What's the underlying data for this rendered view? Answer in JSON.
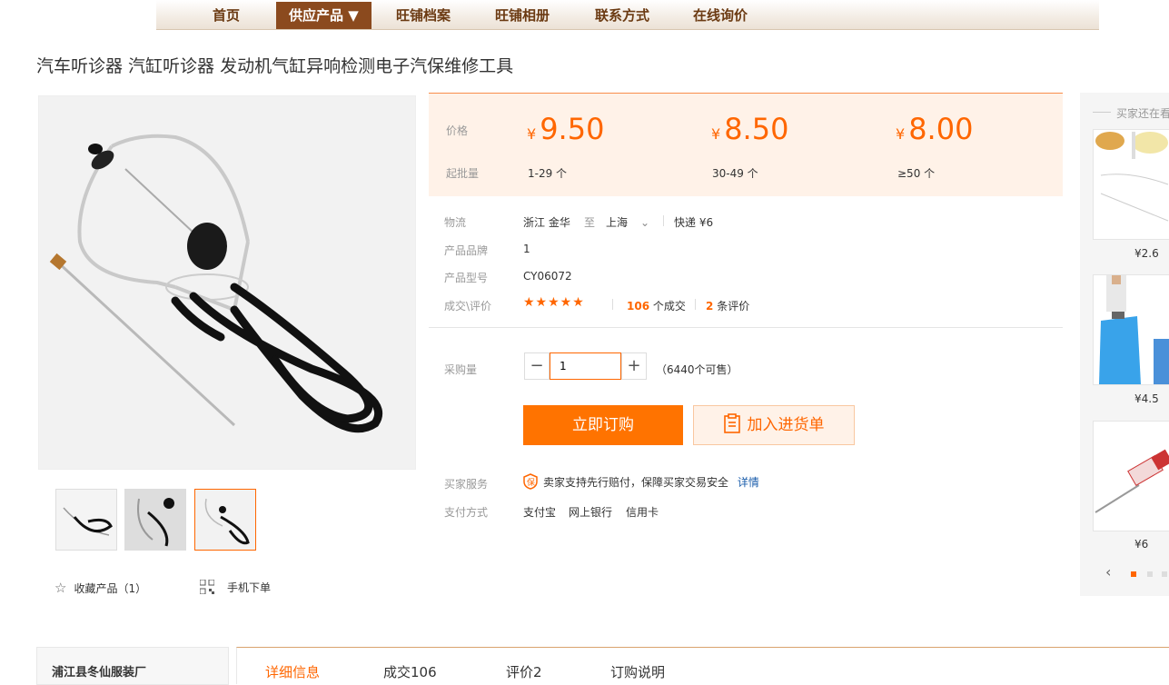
{
  "nav": {
    "items": [
      "首页",
      "供应产品 ▼",
      "旺铺档案",
      "旺铺相册",
      "联系方式",
      "在线询价"
    ],
    "active_index": 1
  },
  "product": {
    "title": "汽车听诊器 汽缸听诊器 发动机气缸异响检测电子汽保维修工具"
  },
  "pricing": {
    "price_label": "价格",
    "moq_label": "起批量",
    "currency": "¥",
    "tiers": [
      {
        "price": "9.50",
        "range": "1-29 个"
      },
      {
        "price": "8.50",
        "range": "30-49 个"
      },
      {
        "price": "8.00",
        "range": "≥50 个"
      }
    ]
  },
  "details": {
    "logistics_label": "物流",
    "origin": "浙江 金华",
    "to": "至",
    "destination": "上海",
    "shipping": "快递 ¥6",
    "brand_label": "产品品牌",
    "brand": "1",
    "model_label": "产品型号",
    "model": "CY06072",
    "rating_label": "成交\\评价",
    "stars": "★★★★★",
    "deals_count": "106",
    "deals_unit": "个成交",
    "reviews_count": "2",
    "reviews_unit": "条评价"
  },
  "purchase": {
    "qty_label": "采购量",
    "qty_value": "1",
    "stock": "（6440个可售）",
    "order_button": "立即订购",
    "cart_button": "加入进货单"
  },
  "service": {
    "buyer_label": "买家服务",
    "guarantee": "卖家支持先行赔付，保障买家交易安全",
    "detail_link": "详情",
    "pay_label": "支付方式",
    "pay_methods": [
      "支付宝",
      "网上银行",
      "信用卡"
    ]
  },
  "gallery": {
    "favorite": "收藏产品（1）",
    "mobile_order": "手机下单",
    "thumb_count": 3,
    "selected_thumb": 3
  },
  "sidebar": {
    "title": "买家还在看",
    "items": [
      {
        "price": "¥2.6"
      },
      {
        "price": "¥4.5"
      },
      {
        "price": "¥6"
      }
    ]
  },
  "bottom": {
    "shop_name": "浦江县冬仙服装厂",
    "tabs": [
      "详细信息",
      "成交106",
      "评价2",
      "订购说明"
    ],
    "active_tab": 0
  },
  "colors": {
    "accent": "#ff6600",
    "nav_active": "#8b4a1e",
    "price_bg": "#fff2e8"
  }
}
